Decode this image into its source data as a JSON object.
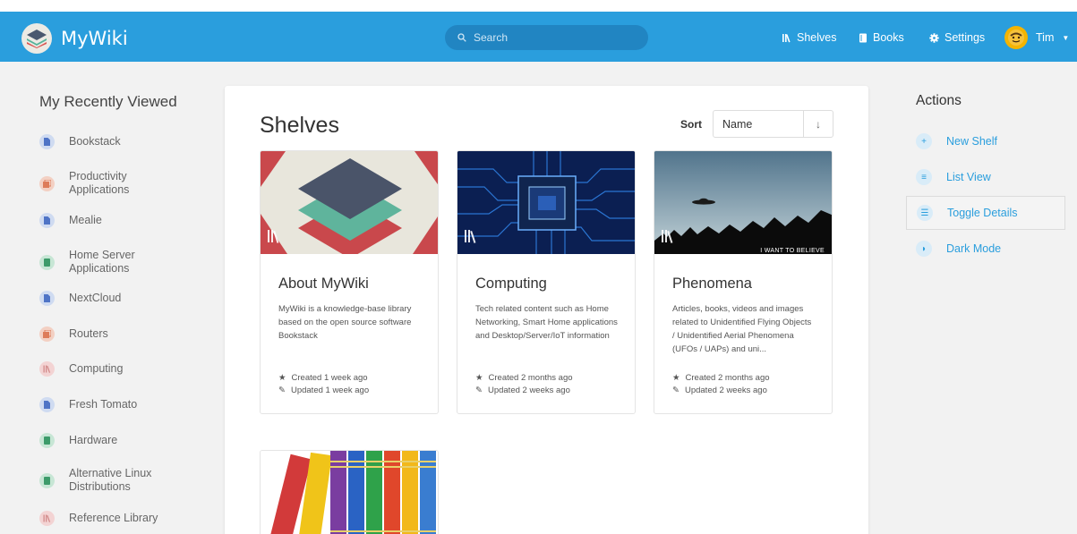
{
  "app": {
    "name": "MyWiki"
  },
  "search": {
    "placeholder": "Search"
  },
  "nav": {
    "shelves": "Shelves",
    "books": "Books",
    "settings": "Settings",
    "user": "Tim"
  },
  "recent": {
    "title": "My Recently Viewed",
    "items": [
      {
        "label": "Bookstack",
        "type": "page"
      },
      {
        "label": "Productivity Applications",
        "type": "chapter"
      },
      {
        "label": "Mealie",
        "type": "page"
      },
      {
        "label": "Home Server Applications",
        "type": "book"
      },
      {
        "label": "NextCloud",
        "type": "page"
      },
      {
        "label": "Routers",
        "type": "chapter"
      },
      {
        "label": "Computing",
        "type": "shelf"
      },
      {
        "label": "Fresh Tomato",
        "type": "page"
      },
      {
        "label": "Hardware",
        "type": "book"
      },
      {
        "label": "Alternative Linux Distributions",
        "type": "book"
      },
      {
        "label": "Reference Library",
        "type": "shelf"
      }
    ]
  },
  "main": {
    "title": "Shelves",
    "sort_label": "Sort",
    "sort_value": "Name",
    "sort_dir": "↓",
    "shelves": [
      {
        "title": "About MyWiki",
        "desc": "MyWiki is a knowledge-base library based on the open source software Bookstack",
        "created": "Created 1 week ago",
        "updated": "Updated 1 week ago"
      },
      {
        "title": "Computing",
        "desc": "Tech related content such as Home Networking, Smart Home applications and Desktop/Server/IoT information",
        "created": "Created 2 months ago",
        "updated": "Updated 2 weeks ago"
      },
      {
        "title": "Phenomena",
        "desc": "Articles, books, videos and images related to Unidentified Flying Objects / Unidentified Aerial Phenomena (UFOs / UAPs) and uni...",
        "created": "Created 2 months ago",
        "updated": "Updated 2 weeks ago",
        "image_caption": "I WANT TO BELIEVE"
      }
    ]
  },
  "actions": {
    "title": "Actions",
    "items": [
      {
        "label": "New Shelf",
        "icon": "plus-icon"
      },
      {
        "label": "List View",
        "icon": "list-icon"
      },
      {
        "label": "Toggle Details",
        "icon": "details-icon"
      },
      {
        "label": "Dark Mode",
        "icon": "moon-icon"
      }
    ]
  },
  "colors": {
    "header": "#2a9edd",
    "accent": "#2a9edd"
  }
}
